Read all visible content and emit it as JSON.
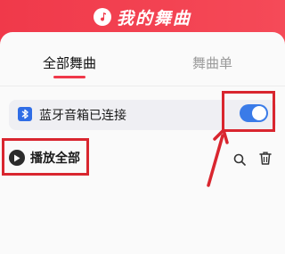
{
  "header": {
    "title": "我的舞曲"
  },
  "tabs": [
    {
      "label": "全部舞曲",
      "active": true
    },
    {
      "label": "舞曲单",
      "active": false
    }
  ],
  "bluetooth": {
    "label": "蓝牙音箱已连接",
    "enabled": true
  },
  "toolbar": {
    "play_all_label": "播放全部"
  },
  "colors": {
    "header_red": "#f0394a",
    "toggle_blue": "#3a7be8",
    "highlight_red": "#d9262f"
  },
  "icons": [
    "music-note-icon",
    "bluetooth-icon",
    "play-icon",
    "search-icon",
    "trash-icon",
    "arrow-icon"
  ]
}
